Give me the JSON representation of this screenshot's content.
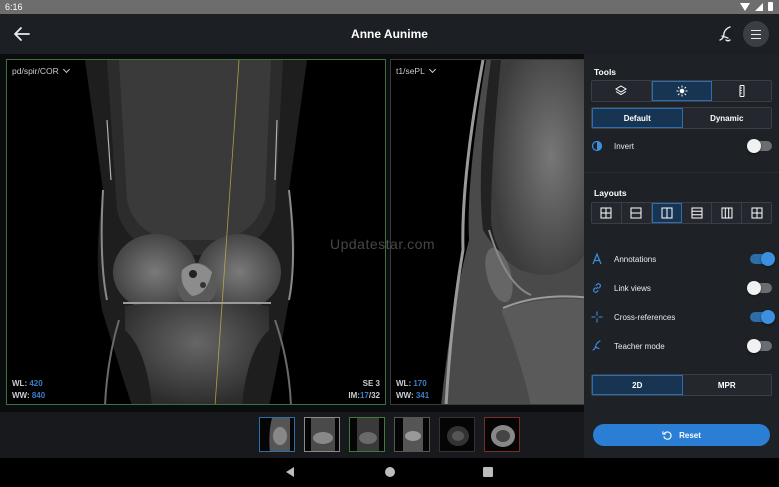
{
  "status_bar": {
    "time": "6:16"
  },
  "app_bar": {
    "title": "Anne Aunime"
  },
  "viewports": [
    {
      "series": "pd/spir/COR",
      "wl_label": "WL:",
      "wl": "420",
      "ww_label": "WW:",
      "ww": "840",
      "se": "SE 3",
      "im_label": "IM:",
      "im_current": "17",
      "im_total": "/32"
    },
    {
      "series": "t1/sePL",
      "wl_label": "WL:",
      "wl": "170",
      "ww_label": "WW:",
      "ww": "341"
    }
  ],
  "watermark": "Updatestar.com",
  "thumbnails": [
    {
      "border_color": "#2f6ead"
    },
    {
      "border_color": "#8a8a8a"
    },
    {
      "border_color": "#3f7a3b"
    },
    {
      "border_color": "#555555"
    },
    {
      "border_color": "#333333"
    },
    {
      "border_color": "#7a2b2b"
    }
  ],
  "panel": {
    "tools_title": "Tools",
    "tool_tabs": [
      "layers-icon",
      "brightness-icon",
      "ruler-icon"
    ],
    "tool_active": 1,
    "preset_tabs": [
      "Default",
      "Dynamic"
    ],
    "preset_active": 0,
    "invert_label": "Invert",
    "invert_on": false,
    "layouts_title": "Layouts",
    "layout_icons": [
      "layout-2x2-icon",
      "layout-1x2-icon",
      "layout-2x1-icon",
      "layout-3-rows-icon",
      "layout-3-cols-icon",
      "layout-grid-icon"
    ],
    "layout_active": 2,
    "options": [
      {
        "label": "Annotations",
        "icon": "annotation-icon",
        "on": true
      },
      {
        "label": "Link views",
        "icon": "link-icon",
        "on": false
      },
      {
        "label": "Cross-references",
        "icon": "crosshair-icon",
        "on": true
      },
      {
        "label": "Teacher mode",
        "icon": "teacher-icon",
        "on": false
      }
    ],
    "mode_tabs": [
      "2D",
      "MPR"
    ],
    "mode_active": 0,
    "reset_label": "Reset"
  },
  "colors": {
    "accent": "#2a7ed4",
    "panel_bg": "#1e2126",
    "active_viewport_border": "#3f6f3b"
  }
}
